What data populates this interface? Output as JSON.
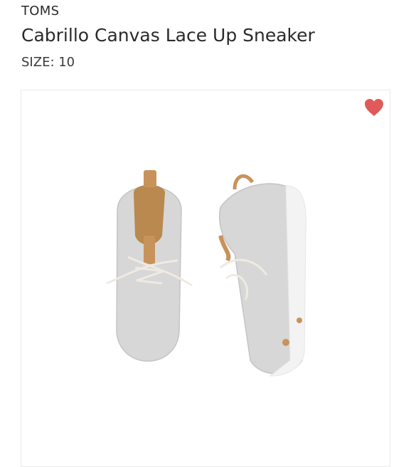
{
  "product": {
    "brand": "TOMS",
    "name": "Cabrillo Canvas Lace Up Sneaker",
    "size_text": "SIZE: 10"
  },
  "icons": {
    "favorite": "heart-icon"
  },
  "colors": {
    "heart": "#e05a5a",
    "canvas": "#d7d7d7",
    "sole": "#f3f3f3",
    "leather": "#c8935a"
  }
}
